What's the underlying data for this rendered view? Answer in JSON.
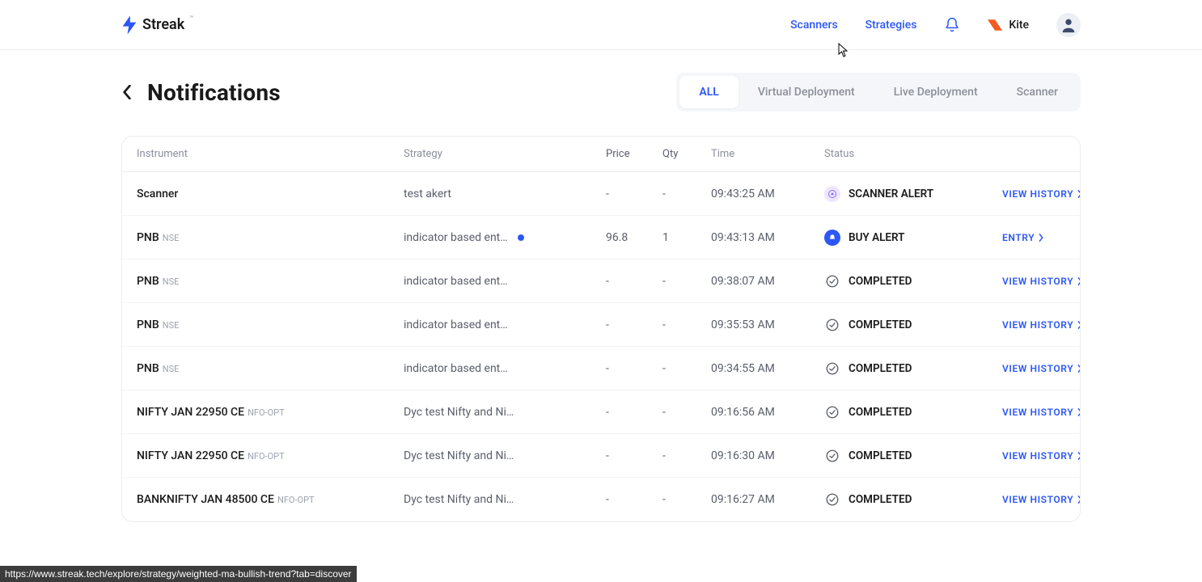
{
  "header": {
    "brand": "Streak",
    "tm": "™",
    "nav": {
      "scanners": "Scanners",
      "strategies": "Strategies",
      "kite": "Kite"
    }
  },
  "page": {
    "title": "Notifications"
  },
  "tabs": [
    {
      "label": "ALL",
      "active": true
    },
    {
      "label": "Virtual Deployment",
      "active": false
    },
    {
      "label": "Live Deployment",
      "active": false
    },
    {
      "label": "Scanner",
      "active": false
    }
  ],
  "columns": {
    "instrument": "Instrument",
    "strategy": "Strategy",
    "price": "Price",
    "qty": "Qty",
    "time": "Time",
    "status": "Status"
  },
  "actions": {
    "view_history": "VIEW HISTORY",
    "entry": "ENTRY"
  },
  "rows": [
    {
      "instrument": "Scanner",
      "exchange": "",
      "strategy": "test akert",
      "dot": false,
      "price": "-",
      "qty": "-",
      "time": "09:43:25 AM",
      "status_type": "scanner",
      "status_text": "SCANNER ALERT",
      "action": "view_history"
    },
    {
      "instrument": "PNB",
      "exchange": "NSE",
      "strategy": "indicator based ent…",
      "dot": true,
      "price": "96.8",
      "qty": "1",
      "time": "09:43:13 AM",
      "status_type": "buy",
      "status_text": "BUY ALERT",
      "action": "entry"
    },
    {
      "instrument": "PNB",
      "exchange": "NSE",
      "strategy": "indicator based ent…",
      "dot": false,
      "price": "-",
      "qty": "-",
      "time": "09:38:07 AM",
      "status_type": "completed",
      "status_text": "COMPLETED",
      "action": "view_history"
    },
    {
      "instrument": "PNB",
      "exchange": "NSE",
      "strategy": "indicator based ent…",
      "dot": false,
      "price": "-",
      "qty": "-",
      "time": "09:35:53 AM",
      "status_type": "completed",
      "status_text": "COMPLETED",
      "action": "view_history"
    },
    {
      "instrument": "PNB",
      "exchange": "NSE",
      "strategy": "indicator based ent…",
      "dot": false,
      "price": "-",
      "qty": "-",
      "time": "09:34:55 AM",
      "status_type": "completed",
      "status_text": "COMPLETED",
      "action": "view_history"
    },
    {
      "instrument": "NIFTY JAN 22950 CE",
      "exchange": "NFO-OPT",
      "strategy": "Dyc test Nifty and Ni…",
      "dot": false,
      "price": "-",
      "qty": "-",
      "time": "09:16:56 AM",
      "status_type": "completed",
      "status_text": "COMPLETED",
      "action": "view_history"
    },
    {
      "instrument": "NIFTY JAN 22950 CE",
      "exchange": "NFO-OPT",
      "strategy": "Dyc test Nifty and Ni…",
      "dot": false,
      "price": "-",
      "qty": "-",
      "time": "09:16:30 AM",
      "status_type": "completed",
      "status_text": "COMPLETED",
      "action": "view_history"
    },
    {
      "instrument": "BANKNIFTY JAN 48500 CE",
      "exchange": "NFO-OPT",
      "strategy": "Dyc test Nifty and Ni…",
      "dot": false,
      "price": "-",
      "qty": "-",
      "time": "09:16:27 AM",
      "status_type": "completed",
      "status_text": "COMPLETED",
      "action": "view_history"
    }
  ],
  "status_url": "https://www.streak.tech/explore/strategy/weighted-ma-bullish-trend?tab=discover"
}
